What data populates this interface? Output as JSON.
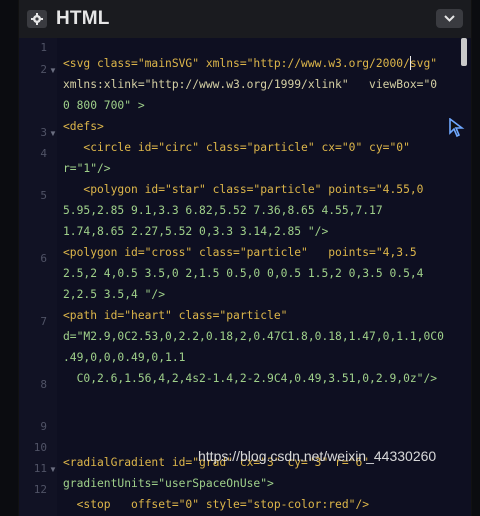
{
  "header": {
    "title": "HTML",
    "gear_icon": "gear-icon",
    "collapse_icon": "chevron-down-icon"
  },
  "editor": {
    "line_numbers": [
      "1",
      "2",
      "3",
      "4",
      "5",
      "6",
      "7",
      "8",
      "9",
      "10",
      "11",
      "12"
    ],
    "rows": [
      "<svg class=\"mainSVG\" xmlns=\"http://www.w3.org/2000/svg\"",
      "xmlns:xlink=\"http://www.w3.org/1999/xlink\"   viewBox=\"0",
      "0 800 700\" >",
      "<defs>",
      "   <circle id=\"circ\" class=\"particle\" cx=\"0\" cy=\"0\"",
      "r=\"1\"/>",
      "   <polygon id=\"star\" class=\"particle\" points=\"4.55,0",
      "5.95,2.85 9.1,3.3 6.82,5.52 7.36,8.65 4.55,7.17",
      "1.74,8.65 2.27,5.52 0,3.3 3.14,2.85 \"/>",
      "<polygon id=\"cross\" class=\"particle\"   points=\"4,3.5",
      "2.5,2 4,0.5 3.5,0 2,1.5 0.5,0 0,0.5 1.5,2 0,3.5 0.5,4",
      "2,2.5 3.5,4 \"/>",
      "<path id=\"heart\" class=\"particle\"",
      "d=\"M2.9,0C2.53,0,2.2,0.18,2,0.47C1.8,0.18,1.47,0,1.1,0C0",
      ".49,0,0,0.49,0,1.1",
      "  C0,2.6,1.56,4,2,4s2-1.4,2-2.9C4,0.49,3.51,0,2.9,0z\"/>",
      "<radialGradient id=\"grad\" cx=\"3\" cy=\"3\" r=\"6\"",
      "gradientUnits=\"userSpaceOnUse\">",
      "  <stop   offset=\"0\" style=\"stop-color:red\"/>"
    ]
  },
  "watermark": "https://blog.csdn.net/weixin_44330260"
}
